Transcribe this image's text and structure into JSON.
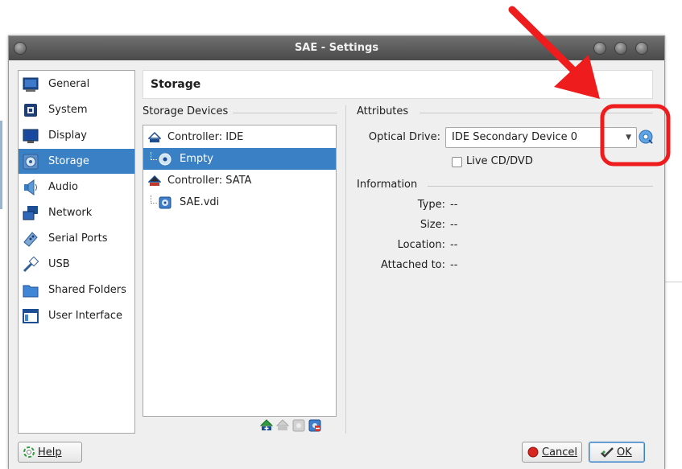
{
  "window": {
    "title": "SAE - Settings"
  },
  "sidebar": {
    "items": [
      {
        "label": "General",
        "icon": "general-icon"
      },
      {
        "label": "System",
        "icon": "system-chip-icon"
      },
      {
        "label": "Display",
        "icon": "display-monitor-icon"
      },
      {
        "label": "Storage",
        "icon": "storage-disk-icon",
        "selected": true
      },
      {
        "label": "Audio",
        "icon": "audio-speaker-icon"
      },
      {
        "label": "Network",
        "icon": "network-icon"
      },
      {
        "label": "Serial Ports",
        "icon": "serial-port-icon"
      },
      {
        "label": "USB",
        "icon": "usb-plug-icon"
      },
      {
        "label": "Shared Folders",
        "icon": "folder-icon"
      },
      {
        "label": "User Interface",
        "icon": "user-interface-icon"
      }
    ]
  },
  "page": {
    "title": "Storage"
  },
  "storage_devices": {
    "title": "Storage Devices",
    "tree": [
      {
        "label": "Controller: IDE",
        "type": "controller"
      },
      {
        "label": "Empty",
        "type": "optical",
        "selected": true
      },
      {
        "label": "Controller: SATA",
        "type": "controller"
      },
      {
        "label": "SAE.vdi",
        "type": "disk"
      }
    ]
  },
  "attributes": {
    "title": "Attributes",
    "optical_drive_label": "Optical Drive:",
    "optical_drive_value": "IDE Secondary Device 0",
    "live_cd_label": "Live CD/DVD",
    "live_cd_checked": false
  },
  "information": {
    "title": "Information",
    "type_label": "Type:",
    "type_value": "--",
    "size_label": "Size:",
    "size_value": "--",
    "location_label": "Location:",
    "location_value": "--",
    "attached_label": "Attached to:",
    "attached_value": "--"
  },
  "buttons": {
    "help": "Help",
    "cancel": "Cancel",
    "ok": "OK"
  },
  "annotation": {
    "color": "#ee1c1c"
  },
  "colors": {
    "selection": "#3a80c4",
    "titlebar": "#5a5a5a"
  }
}
